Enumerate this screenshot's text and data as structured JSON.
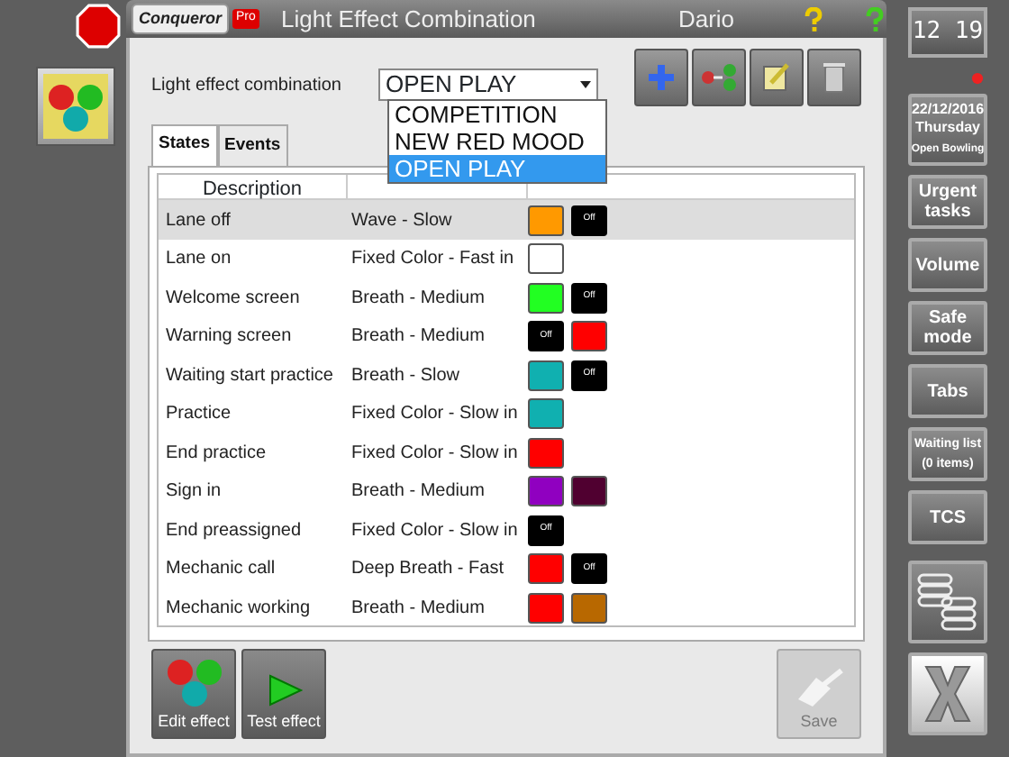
{
  "window": {
    "logo": "Conqueror",
    "logo_badge": "Pro",
    "title": "Light Effect Combination",
    "user": "Dario"
  },
  "combination": {
    "label": "Light effect combination",
    "value": "OPEN PLAY",
    "expanded": true,
    "options": [
      {
        "label": "COMPETITION",
        "selected": false
      },
      {
        "label": "NEW RED MOOD",
        "selected": false
      },
      {
        "label": "OPEN PLAY",
        "selected": true
      }
    ]
  },
  "tabs": [
    {
      "label": "States",
      "selected": true
    },
    {
      "label": "Events",
      "selected": false
    }
  ],
  "table": {
    "columns": [
      "Description"
    ],
    "rows": [
      {
        "description": "Lane off",
        "effect": "Wave - Slow",
        "selected": true,
        "swatches": [
          {
            "kind": "color",
            "color": "#ff9900"
          },
          {
            "kind": "off",
            "label": "Off"
          }
        ]
      },
      {
        "description": "Lane on",
        "effect": "Fixed Color - Fast in",
        "selected": false,
        "swatches": [
          {
            "kind": "color",
            "color": "#ffffff"
          }
        ]
      },
      {
        "description": "Welcome screen",
        "effect": "Breath - Medium",
        "selected": false,
        "swatches": [
          {
            "kind": "color",
            "color": "#22ff22"
          },
          {
            "kind": "off",
            "label": "Off"
          }
        ]
      },
      {
        "description": "Warning screen",
        "effect": "Breath - Medium",
        "selected": false,
        "swatches": [
          {
            "kind": "off",
            "label": "Off"
          },
          {
            "kind": "color",
            "color": "#ff0000"
          }
        ]
      },
      {
        "description": "Waiting start practice",
        "effect": "Breath - Slow",
        "selected": false,
        "swatches": [
          {
            "kind": "color",
            "color": "#10b0b0"
          },
          {
            "kind": "off",
            "label": "Off"
          }
        ]
      },
      {
        "description": "Practice",
        "effect": "Fixed Color - Slow in",
        "selected": false,
        "swatches": [
          {
            "kind": "color",
            "color": "#10b0b0"
          }
        ]
      },
      {
        "description": "End practice",
        "effect": "Fixed Color - Slow in",
        "selected": false,
        "swatches": [
          {
            "kind": "color",
            "color": "#ff0000"
          }
        ]
      },
      {
        "description": "Sign in",
        "effect": "Breath - Medium",
        "selected": false,
        "swatches": [
          {
            "kind": "color",
            "color": "#9000c0"
          },
          {
            "kind": "color",
            "color": "#500030"
          }
        ]
      },
      {
        "description": "End preassigned",
        "effect": "Fixed Color - Slow in",
        "selected": false,
        "swatches": [
          {
            "kind": "off",
            "label": "Off"
          }
        ]
      },
      {
        "description": "Mechanic call",
        "effect": "Deep Breath - Fast",
        "selected": false,
        "swatches": [
          {
            "kind": "color",
            "color": "#ff0000"
          },
          {
            "kind": "off",
            "label": "Off"
          }
        ]
      },
      {
        "description": "Mechanic working",
        "effect": "Breath - Medium",
        "selected": false,
        "swatches": [
          {
            "kind": "color",
            "color": "#ff0000"
          },
          {
            "kind": "color",
            "color": "#b86800"
          }
        ]
      }
    ]
  },
  "bottom_buttons": [
    {
      "label": "Edit effect",
      "kind": "lights",
      "disabled": false
    },
    {
      "label": "Test effect",
      "kind": "play",
      "disabled": false
    },
    {
      "label": "Save",
      "kind": "save",
      "disabled": true
    }
  ],
  "sidebar": {
    "clock": "12 19",
    "date": "22/12/2016",
    "weekday": "Thursday",
    "mode": "Open Bowling",
    "buttons": [
      "Urgent tasks",
      "Volume",
      "Safe mode",
      "Tabs",
      "Waiting list (0 items)",
      "TCS"
    ]
  }
}
